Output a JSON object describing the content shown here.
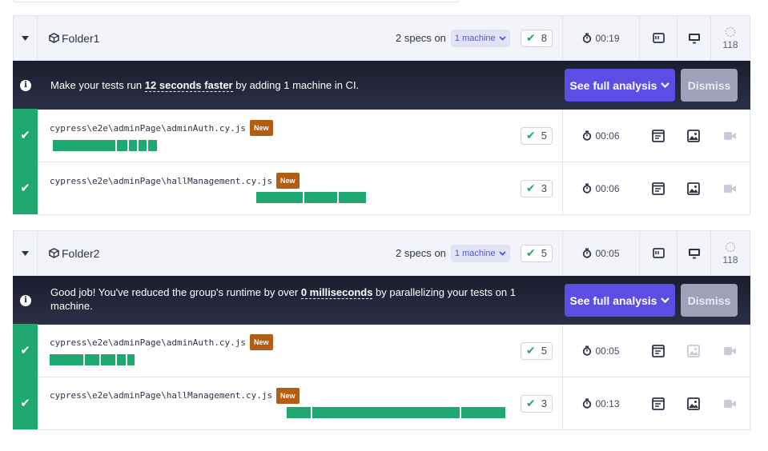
{
  "groups": [
    {
      "folder_name": "Folder1",
      "specs_text": "2 specs",
      "on_text": "on",
      "machine_label": "1 machine",
      "passed": "8",
      "duration": "00:19",
      "count": "118",
      "banner": {
        "text_before": "Make your tests run ",
        "highlight": "12 seconds faster",
        "text_after": " by adding 1 machine in CI.",
        "full_button": "See full analysis",
        "dismiss_button": "Dismiss"
      },
      "specs": [
        {
          "path": "cypress\\e2e\\adminPage\\adminAuth.cy.js",
          "badge": "New",
          "passed": "5",
          "duration": "00:06",
          "screenshot_active": true
        },
        {
          "path": "cypress\\e2e\\adminPage\\hallManagement.cy.js",
          "badge": "New",
          "passed": "3",
          "duration": "00:06",
          "screenshot_active": true
        }
      ]
    },
    {
      "folder_name": "Folder2",
      "specs_text": "2 specs",
      "on_text": "on",
      "machine_label": "1 machine",
      "passed": "5",
      "duration": "00:05",
      "count": "118",
      "banner": {
        "text_before": "Good job! You've reduced the group's runtime by over ",
        "highlight": "0 milliseconds",
        "text_after": " by parallelizing your tests on 1 machine.",
        "full_button": "See full analysis",
        "dismiss_button": "Dismiss"
      },
      "specs": [
        {
          "path": "cypress\\e2e\\adminPage\\adminAuth.cy.js",
          "badge": "New",
          "passed": "5",
          "duration": "00:05",
          "screenshot_active": false
        },
        {
          "path": "cypress\\e2e\\adminPage\\hallManagement.cy.js",
          "badge": "New",
          "passed": "3",
          "duration": "00:13",
          "screenshot_active": true
        }
      ]
    }
  ],
  "colors": {
    "pass_green": "#1fa971",
    "banner_bg": "#1b1e2e",
    "primary_button": "#5c4ee5",
    "secondary_button": "#9ea1b8",
    "new_badge": "#b35c12",
    "machine_pill_text": "#4956e3"
  },
  "icons": [
    "chevron-down-icon",
    "cube-icon",
    "check-icon",
    "stopwatch-icon",
    "terminal-log-icon",
    "monitor-icon",
    "cypress-logo-icon",
    "info-icon",
    "image-icon",
    "video-camera-icon"
  ]
}
